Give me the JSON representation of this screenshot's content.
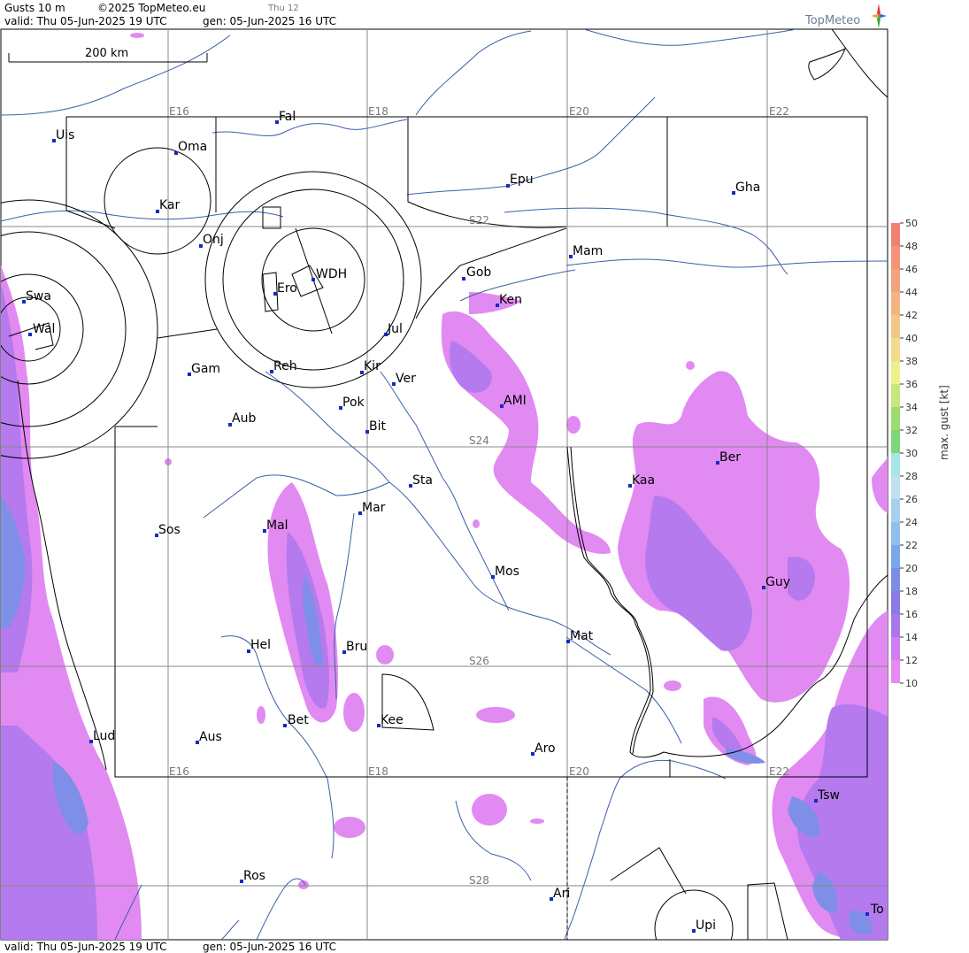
{
  "header": {
    "product": "Gusts 10 m",
    "copyright": "©2025 TopMeteo.eu",
    "day": "Thu 12",
    "valid": "valid:  Thu  05-Jun-2025  19 UTC",
    "generated": "gen: 05-Jun-2025 16 UTC",
    "brand": "TopMeteo"
  },
  "footer": {
    "valid": "valid:  Thu  05-Jun-2025  19 UTC",
    "generated": "gen: 05-Jun-2025 16 UTC"
  },
  "scale": {
    "label": "200 km"
  },
  "grid": {
    "lon_labels_top": [
      "E16",
      "E18",
      "E20",
      "E22"
    ],
    "lon_labels_bottom": [
      "E16",
      "E18",
      "E20",
      "E22"
    ],
    "lat_labels": [
      "S22",
      "S24",
      "S26",
      "S28"
    ]
  },
  "places": [
    "Uis",
    "Fal",
    "Oma",
    "Kar",
    "Epu",
    "Gha",
    "Onj",
    "WDH",
    "Ero",
    "Mam",
    "Gob",
    "Ken",
    "Swa",
    "Wal",
    "Jul",
    "Gam",
    "Reh",
    "Kir",
    "Ver",
    "AMI",
    "Pok",
    "Aub",
    "Bit",
    "Ber",
    "Sta",
    "Kaa",
    "Sos",
    "Mal",
    "Mar",
    "Mos",
    "Guy",
    "Mat",
    "Hel",
    "Bru",
    "Bet",
    "Kee",
    "Lud",
    "Aus",
    "Aro",
    "Tsw",
    "Ros",
    "Ari",
    "To",
    "Upi"
  ],
  "legend": {
    "title": "max. gust [kt]",
    "ticks": [
      "50",
      "48",
      "46",
      "44",
      "42",
      "40",
      "38",
      "36",
      "34",
      "32",
      "30",
      "28",
      "26",
      "24",
      "22",
      "20",
      "18",
      "16",
      "14",
      "12",
      "10"
    ],
    "colors": [
      "#f28070",
      "#f49377",
      "#f2a27e",
      "#f2b582",
      "#f2c88a",
      "#f2db8c",
      "#eef08c",
      "#c6e87a",
      "#9edb6f",
      "#7dd67a",
      "#a6e6e6",
      "#bfe0f0",
      "#a8d0ee",
      "#8ec0ec",
      "#78a8e8",
      "#7a8ee6",
      "#8a7ae6",
      "#a978ec",
      "#cf7ef0",
      "#e788f4"
    ]
  }
}
